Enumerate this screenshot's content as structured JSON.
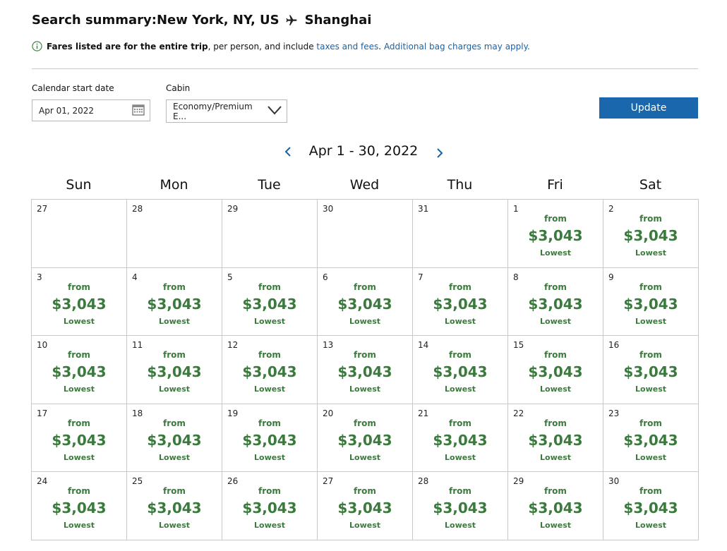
{
  "summary": {
    "prefix": "Search summary: ",
    "origin": "New York, NY, US",
    "destination": "Shanghai"
  },
  "notice": {
    "bold": "Fares listed are for the entire trip",
    "text": ", per person, and include ",
    "link1": "taxes and fees",
    "sep": ". ",
    "link2": "Additional bag charges may apply."
  },
  "form": {
    "date_label": "Calendar start date",
    "date_value": "Apr 01, 2022",
    "cabin_label": "Cabin",
    "cabin_value": "Economy/Premium E...",
    "update_label": "Update"
  },
  "calendar": {
    "month_label": "Apr 1 - 30, 2022",
    "weekdays": [
      "Sun",
      "Mon",
      "Tue",
      "Wed",
      "Thu",
      "Fri",
      "Sat"
    ],
    "days": [
      {
        "day": "27"
      },
      {
        "day": "28"
      },
      {
        "day": "29"
      },
      {
        "day": "30"
      },
      {
        "day": "31"
      },
      {
        "day": "1",
        "from": "from",
        "price": "$3,043",
        "note": "Lowest"
      },
      {
        "day": "2",
        "from": "from",
        "price": "$3,043",
        "note": "Lowest"
      },
      {
        "day": "3",
        "from": "from",
        "price": "$3,043",
        "note": "Lowest"
      },
      {
        "day": "4",
        "from": "from",
        "price": "$3,043",
        "note": "Lowest"
      },
      {
        "day": "5",
        "from": "from",
        "price": "$3,043",
        "note": "Lowest"
      },
      {
        "day": "6",
        "from": "from",
        "price": "$3,043",
        "note": "Lowest"
      },
      {
        "day": "7",
        "from": "from",
        "price": "$3,043",
        "note": "Lowest"
      },
      {
        "day": "8",
        "from": "from",
        "price": "$3,043",
        "note": "Lowest"
      },
      {
        "day": "9",
        "from": "from",
        "price": "$3,043",
        "note": "Lowest"
      },
      {
        "day": "10",
        "from": "from",
        "price": "$3,043",
        "note": "Lowest"
      },
      {
        "day": "11",
        "from": "from",
        "price": "$3,043",
        "note": "Lowest"
      },
      {
        "day": "12",
        "from": "from",
        "price": "$3,043",
        "note": "Lowest"
      },
      {
        "day": "13",
        "from": "from",
        "price": "$3,043",
        "note": "Lowest"
      },
      {
        "day": "14",
        "from": "from",
        "price": "$3,043",
        "note": "Lowest"
      },
      {
        "day": "15",
        "from": "from",
        "price": "$3,043",
        "note": "Lowest"
      },
      {
        "day": "16",
        "from": "from",
        "price": "$3,043",
        "note": "Lowest"
      },
      {
        "day": "17",
        "from": "from",
        "price": "$3,043",
        "note": "Lowest"
      },
      {
        "day": "18",
        "from": "from",
        "price": "$3,043",
        "note": "Lowest"
      },
      {
        "day": "19",
        "from": "from",
        "price": "$3,043",
        "note": "Lowest"
      },
      {
        "day": "20",
        "from": "from",
        "price": "$3,043",
        "note": "Lowest"
      },
      {
        "day": "21",
        "from": "from",
        "price": "$3,043",
        "note": "Lowest"
      },
      {
        "day": "22",
        "from": "from",
        "price": "$3,043",
        "note": "Lowest"
      },
      {
        "day": "23",
        "from": "from",
        "price": "$3,043",
        "note": "Lowest"
      },
      {
        "day": "24",
        "from": "from",
        "price": "$3,043",
        "note": "Lowest"
      },
      {
        "day": "25",
        "from": "from",
        "price": "$3,043",
        "note": "Lowest"
      },
      {
        "day": "26",
        "from": "from",
        "price": "$3,043",
        "note": "Lowest"
      },
      {
        "day": "27",
        "from": "from",
        "price": "$3,043",
        "note": "Lowest"
      },
      {
        "day": "28",
        "from": "from",
        "price": "$3,043",
        "note": "Lowest"
      },
      {
        "day": "29",
        "from": "from",
        "price": "$3,043",
        "note": "Lowest"
      },
      {
        "day": "30",
        "from": "from",
        "price": "$3,043",
        "note": "Lowest"
      }
    ]
  },
  "colors": {
    "fare_green": "#3b7a3d",
    "link_blue": "#1a62a8",
    "button_blue": "#1a67ad"
  }
}
